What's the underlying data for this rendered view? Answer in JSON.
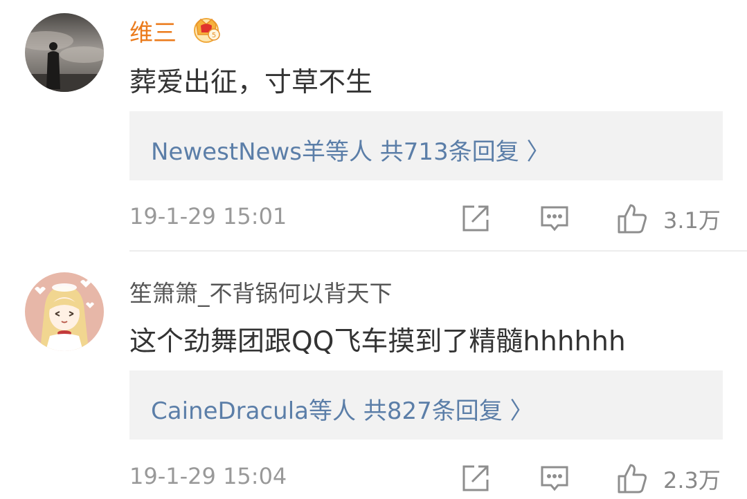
{
  "comments": [
    {
      "username": "维三",
      "text": "葬爱出征，寸草不生",
      "replies_label": "NewestNews羊等人  共713条回复 〉",
      "timestamp": "19-1-29 15:01",
      "likes": "3.1万"
    },
    {
      "username": "笙箫箫_不背锅何以背天下",
      "text": "这个劲舞团跟QQ飞车摸到了精髓hhhhhh",
      "replies_label": "CaineDracula等人  共827条回复 〉",
      "timestamp": "19-1-29 15:04",
      "likes": "2.3万"
    }
  ],
  "icons": {
    "vip": "crown-vip-icon",
    "share": "share-icon",
    "reply": "comment-icon",
    "like": "thumbs-up-icon"
  },
  "colors": {
    "vip_username": "#eb7b1c",
    "username": "#555555",
    "reply_link": "#5b7ea8",
    "reply_box": "#f2f2f2",
    "meta": "#999999"
  }
}
